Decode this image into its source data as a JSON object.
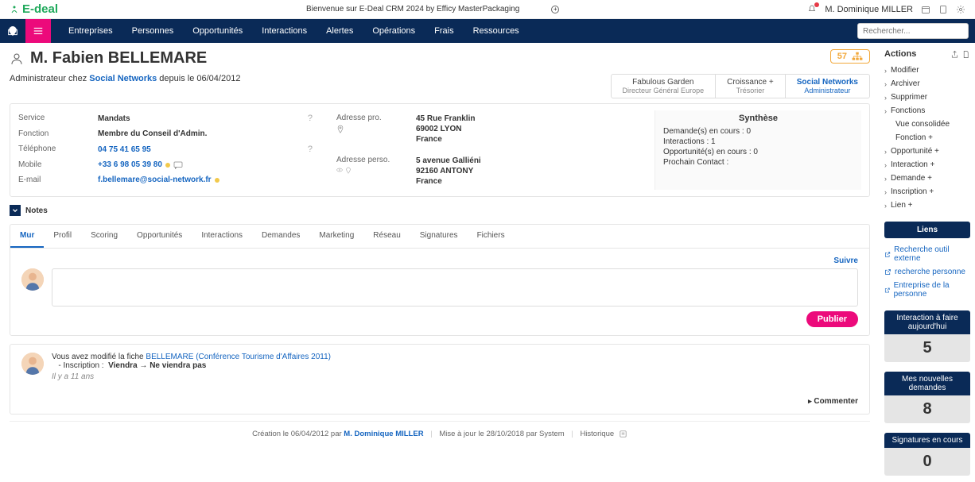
{
  "topbar": {
    "brand": "E-deal",
    "welcome": "Bienvenue sur E-Deal CRM 2024 by Efficy MasterPackaging",
    "user": "M. Dominique MILLER"
  },
  "nav": {
    "items": [
      "Entreprises",
      "Personnes",
      "Opportunités",
      "Interactions",
      "Alertes",
      "Opérations",
      "Frais",
      "Ressources"
    ],
    "search_placeholder": "Rechercher..."
  },
  "header": {
    "title": "M. Fabien BELLEMARE",
    "score": "57"
  },
  "role": {
    "prefix": "Administrateur chez ",
    "company": "Social Networks",
    "suffix": " depuis le 06/04/2012"
  },
  "company_tabs": [
    {
      "name": "Fabulous Garden",
      "role": "Directeur Général Europe"
    },
    {
      "name": "Croissance +",
      "role": "Trésorier"
    },
    {
      "name": "Social Networks",
      "role": "Administrateur"
    }
  ],
  "details": {
    "col1": [
      {
        "label": "Service",
        "value": "Mandats",
        "help": true
      },
      {
        "label": "Fonction",
        "value": "Membre du Conseil d'Admin."
      },
      {
        "label": "Téléphone",
        "value": "04 75 41 65 95",
        "help": true,
        "link": true
      },
      {
        "label": "Mobile",
        "value": "+33 6 98 05 39 80",
        "link": true,
        "phone_icons": true
      },
      {
        "label": "E-mail",
        "value": "f.bellemare@social-network.fr",
        "link": true,
        "email_dot": true
      }
    ],
    "addr_pro_label": "Adresse pro.",
    "addr_pro": [
      "45 Rue Franklin",
      "69002 LYON",
      "France"
    ],
    "addr_perso_label": "Adresse perso.",
    "addr_perso": [
      "5 avenue Galliéni",
      "92160 ANTONY",
      "France"
    ]
  },
  "synthese": {
    "title": "Synthèse",
    "rows": [
      "Demande(s) en cours : 0",
      "Interactions : 1",
      "Opportunité(s) en cours : 0",
      "Prochain Contact :"
    ]
  },
  "notes_label": "Notes",
  "tabs": [
    "Mur",
    "Profil",
    "Scoring",
    "Opportunités",
    "Interactions",
    "Demandes",
    "Marketing",
    "Réseau",
    "Signatures",
    "Fichiers"
  ],
  "suivre": "Suivre",
  "publish": "Publier",
  "activity": {
    "prefix": "Vous avez modifié la fiche ",
    "link": "BELLEMARE (Conférence Tourisme d'Affaires 2011)",
    "change_label": "   - Inscription : ",
    "change_from": "Viendra",
    "change_to": "Ne viendra pas",
    "time": "Il y a 11 ans",
    "comment": "Commenter"
  },
  "footer": {
    "created": "Création le 06/04/2012 par ",
    "created_by": "M. Dominique MILLER",
    "updated": "Mise à jour le 28/10/2018 par System",
    "history": "Historique"
  },
  "sidebar": {
    "actions_title": "Actions",
    "actions": [
      "Modifier",
      "Archiver",
      "Supprimer",
      "Fonctions"
    ],
    "sub_actions": [
      "Vue consolidée",
      "Fonction +"
    ],
    "actions2": [
      "Opportunité +",
      "Interaction +",
      "Demande +",
      "Inscription +",
      "Lien +"
    ],
    "liens_title": "Liens",
    "liens": [
      "Recherche outil externe",
      "recherche personne",
      "Entreprise de la personne"
    ],
    "stats": [
      {
        "title": "Interaction à faire aujourd'hui",
        "value": "5"
      },
      {
        "title": "Mes nouvelles demandes",
        "value": "8"
      },
      {
        "title": "Signatures en cours",
        "value": "0"
      }
    ]
  }
}
